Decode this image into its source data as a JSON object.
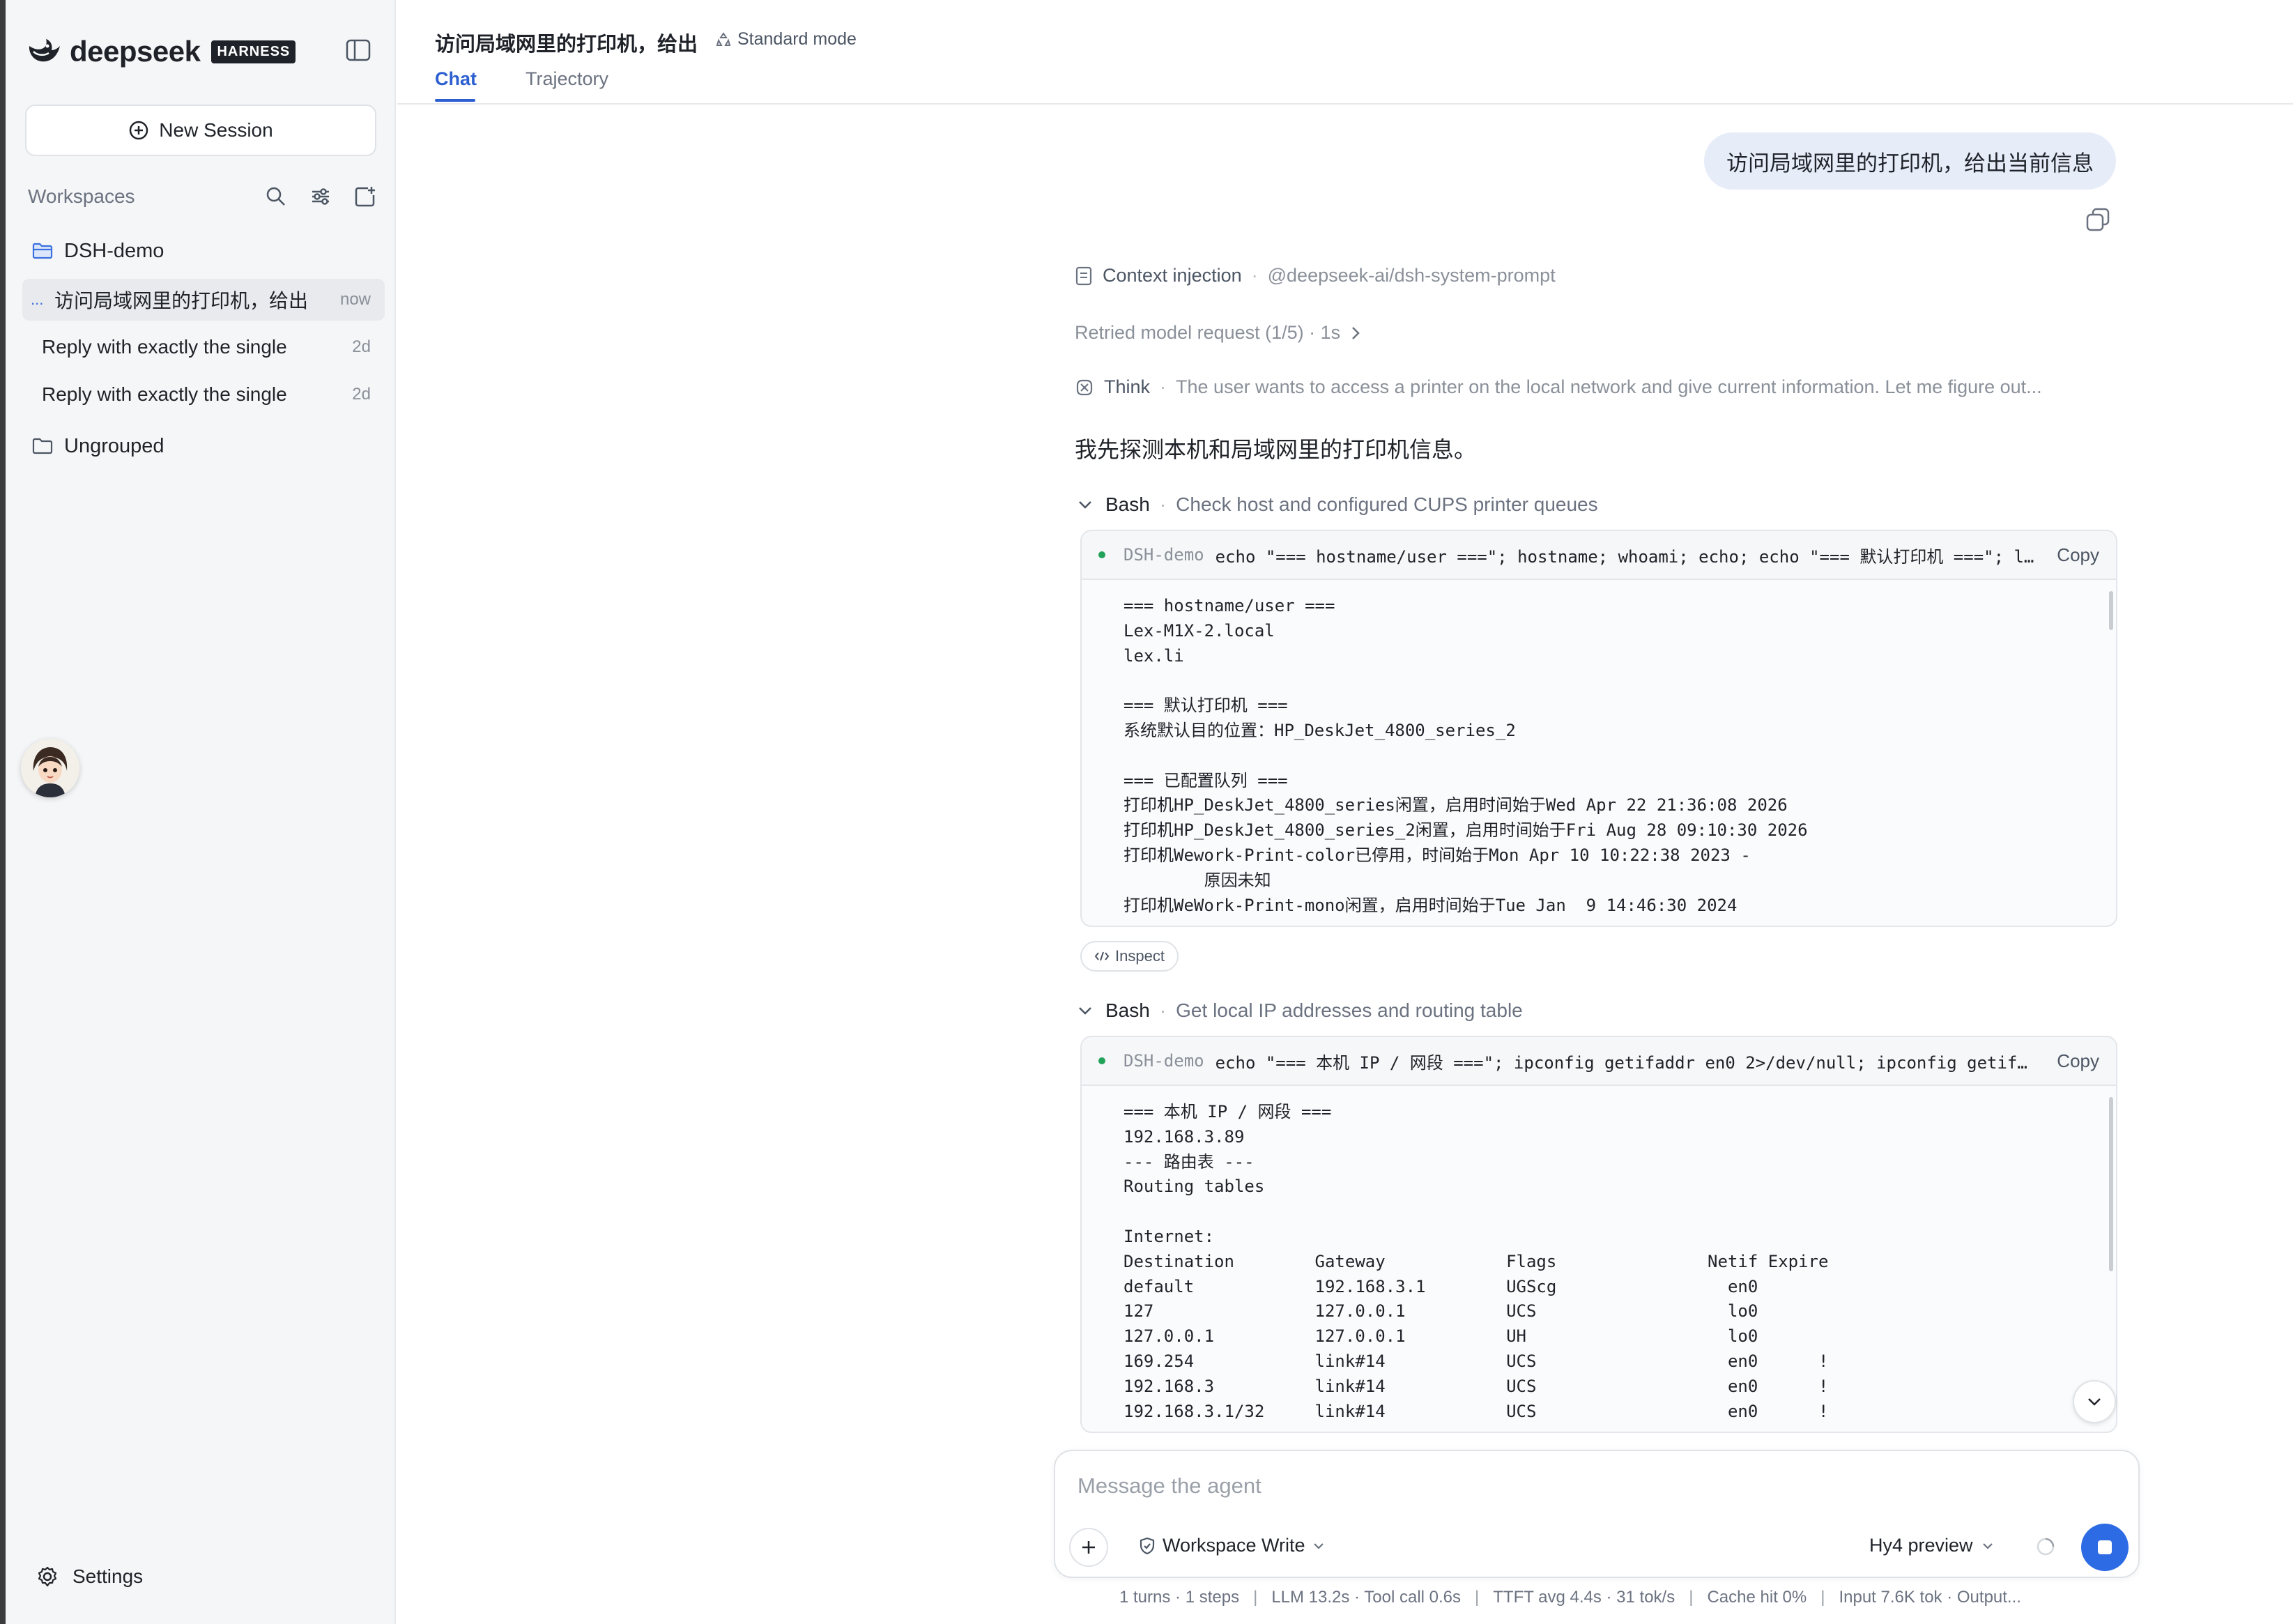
{
  "brand": {
    "name": "deepseek",
    "badge": "HARNESS"
  },
  "sidebar": {
    "new_session_label": "New Session",
    "workspaces_title": "Workspaces",
    "groups": [
      {
        "label": "DSH-demo"
      },
      {
        "label": "Ungrouped"
      }
    ],
    "sessions": [
      {
        "title": "访问局域网里的打印机，给出",
        "time": "now",
        "indicator": "..."
      },
      {
        "title": "Reply with exactly the single",
        "time": "2d"
      },
      {
        "title": "Reply with exactly the single",
        "time": "2d"
      }
    ],
    "settings_label": "Settings"
  },
  "header": {
    "title": "访问局域网里的打印机，给出",
    "mode": "Standard mode",
    "tabs": [
      {
        "label": "Chat",
        "active": true
      },
      {
        "label": "Trajectory"
      }
    ]
  },
  "chat": {
    "user_message": "访问局域网里的打印机，给出当前信息",
    "context": {
      "label": "Context injection",
      "source": "@deepseek-ai/dsh-system-prompt"
    },
    "retry": "Retried model request (1/5) · 1s",
    "think": {
      "label": "Think",
      "text": "The user wants to access a printer on the local network and give current information. Let me figure out..."
    },
    "assistant_text": "我先探测本机和局域网里的打印机信息。",
    "tools": [
      {
        "label": "Bash",
        "description": "Check host and configured CUPS printer queues",
        "workspace": "DSH-demo",
        "command": "echo \"=== hostname/user ===\"; hostname; whoami; echo; echo \"=== 默认打印机 ===\"; l…",
        "copy_label": "Copy",
        "output": "=== hostname/user ===\nLex-M1X-2.local\nlex.li\n\n=== 默认打印机 ===\n系统默认目的位置：HP_DeskJet_4800_series_2\n\n=== 已配置队列 ===\n打印机HP_DeskJet_4800_series闲置，启用时间始于Wed Apr 22 21:36:08 2026\n打印机HP_DeskJet_4800_series_2闲置，启用时间始于Fri Aug 28 09:10:30 2026\n打印机Wework-Print-color已停用，时间始于Mon Apr 10 10:22:38 2023 -\n        原因未知\n打印机WeWork-Print-mono闲置，启用时间始于Tue Jan  9 14:46:30 2024"
      },
      {
        "label": "Bash",
        "description": "Get local IP addresses and routing table",
        "workspace": "DSH-demo",
        "command": "echo \"=== 本机 IP / 网段 ===\"; ipconfig getifaddr en0 2>/dev/null; ipconfig getif…",
        "copy_label": "Copy",
        "output": "=== 本机 IP / 网段 ===\n192.168.3.89\n--- 路由表 ---\nRouting tables\n\nInternet:\nDestination        Gateway            Flags               Netif Expire\ndefault            192.168.3.1        UGScg                 en0\n127                127.0.0.1          UCS                   lo0\n127.0.0.1          127.0.0.1          UH                    lo0\n169.254            link#14            UCS                   en0      !\n192.168.3          link#14            UCS                   en0      !\n192.168.3.1/32     link#14            UCS                   en0      !"
      }
    ],
    "inspect_label": "Inspect"
  },
  "composer": {
    "placeholder": "Message the agent",
    "permission": "Workspace Write",
    "model": "Hy4 preview"
  },
  "stats": {
    "turns": "1 turns · 1 steps",
    "timing": "LLM 13.2s · Tool call 0.6s",
    "ttft": "TTFT avg 4.4s · 31 tok/s",
    "cache": "Cache hit 0%",
    "tokens": "Input 7.6K tok · Output..."
  },
  "colors": {
    "accent": "#2d5fd0",
    "user_bubble": "#e7ecf9",
    "status_ok": "#22a35a",
    "stop_button": "#2d6be4"
  }
}
